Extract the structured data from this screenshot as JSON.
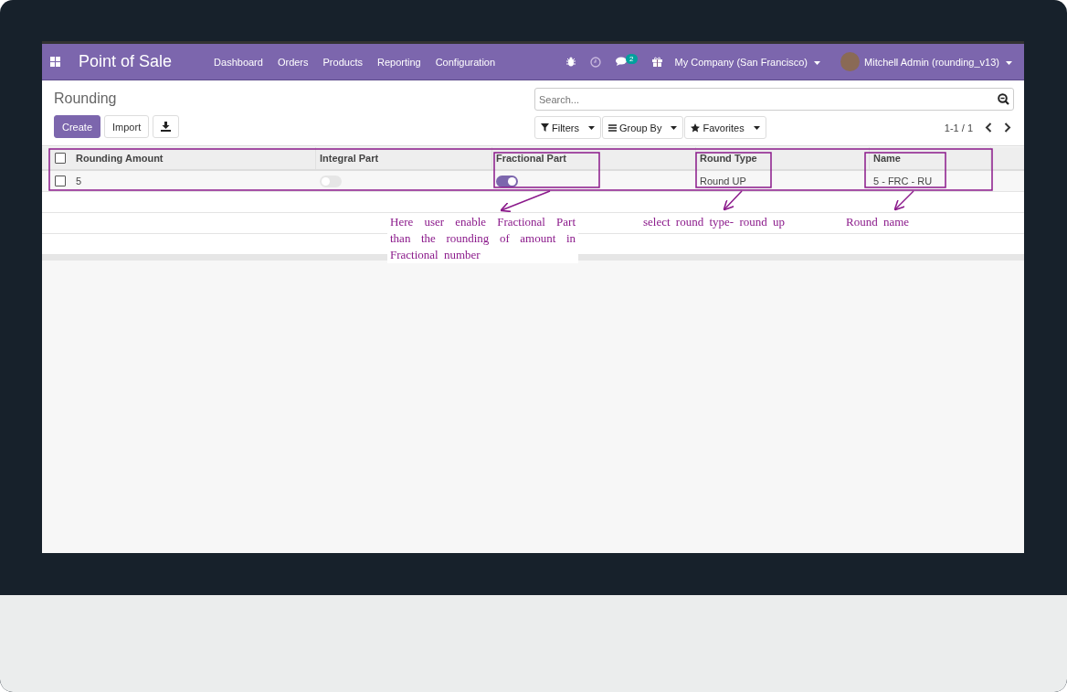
{
  "navbar": {
    "app_title": "Point of Sale",
    "menu": [
      "Dashboard",
      "Orders",
      "Products",
      "Reporting",
      "Configuration"
    ],
    "chat_badge": "2",
    "company": "My Company (San Francisco)",
    "user": "Mitchell Admin (rounding_v13)"
  },
  "breadcrumb": "Rounding",
  "buttons": {
    "create": "Create",
    "import": "Import"
  },
  "search": {
    "placeholder": "Search..."
  },
  "filters": [
    "Filters",
    "Group By",
    "Favorites"
  ],
  "pager": "1-1 / 1",
  "table": {
    "select_all_checked": false,
    "columns": [
      "Rounding Amount",
      "Integral Part",
      "Fractional Part",
      "Round Type",
      "Name"
    ],
    "rows": [
      {
        "checked": false,
        "amount": "5",
        "integral_part": false,
        "fractional_part": true,
        "round_type": "Round UP",
        "name": "5 - FRC - RU"
      }
    ]
  },
  "annotations": [
    "Here user enable Fractional Part than the rounding of amount in Fractional number",
    "select round type- round up",
    "Round name"
  ]
}
